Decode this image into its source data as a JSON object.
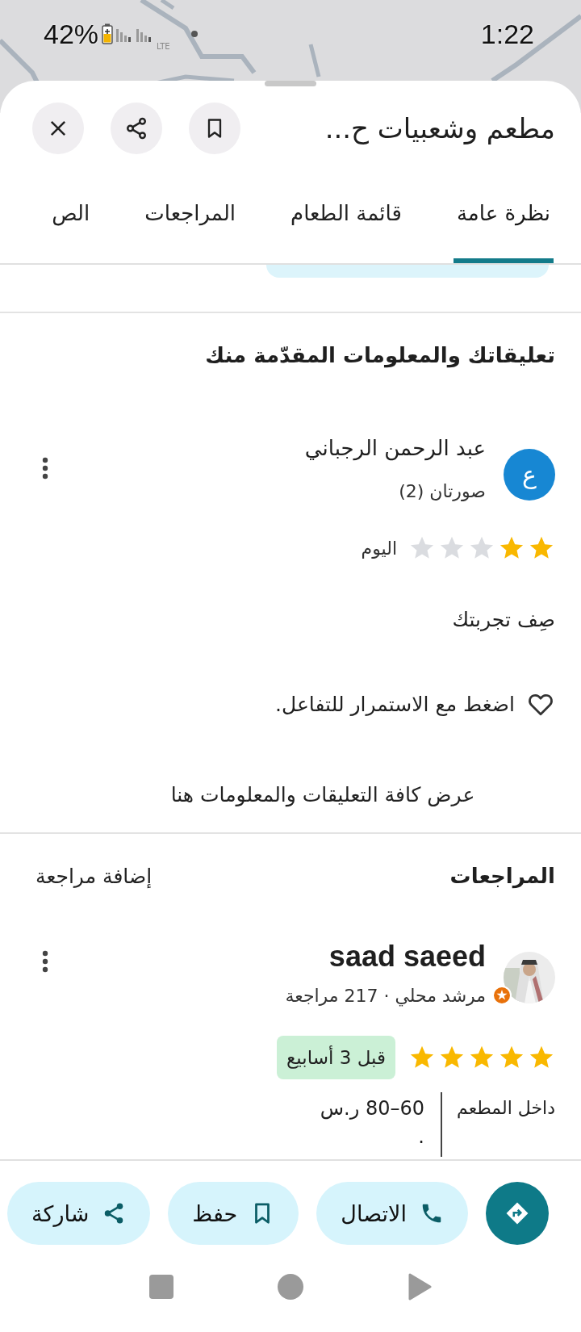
{
  "status_bar": {
    "battery": "42%",
    "network": "LTE",
    "time": "1:22"
  },
  "place": {
    "title": "مطعم وشعبيات ح..."
  },
  "tabs": [
    {
      "label": "نظرة عامة",
      "selected": true
    },
    {
      "label": "قائمة الطعام",
      "selected": false
    },
    {
      "label": "المراجعات",
      "selected": false
    },
    {
      "label": "الص",
      "selected": false
    }
  ],
  "your_contributions": {
    "heading": "تعليقاتك والمعلومات المقدّمة منك",
    "user": {
      "initial": "ع",
      "name": "عبد الرحمن الرجباني",
      "photos": "صورتان (2)",
      "stars": 2,
      "date": "اليوم"
    },
    "prompt": "صِف تجربتك",
    "hint": "اضغط مع الاستمرار للتفاعل.",
    "link": "عرض كافة التعليقات والمعلومات هنا"
  },
  "reviews": {
    "heading": "المراجعات",
    "add": "إضافة مراجعة",
    "items": [
      {
        "name": "saad saeed",
        "meta": "مرشد محلي · 217 مراجعة",
        "stars": 5,
        "time": "قبل 3 أسابيع",
        "service": "داخل المطعم",
        "price": "60–80 ر.س",
        "more": "."
      }
    ]
  },
  "actions": [
    {
      "kind": "directions"
    },
    {
      "kind": "call",
      "label": "الاتصال"
    },
    {
      "kind": "save",
      "label": "حفظ"
    },
    {
      "kind": "share",
      "label": "شاركة"
    }
  ]
}
